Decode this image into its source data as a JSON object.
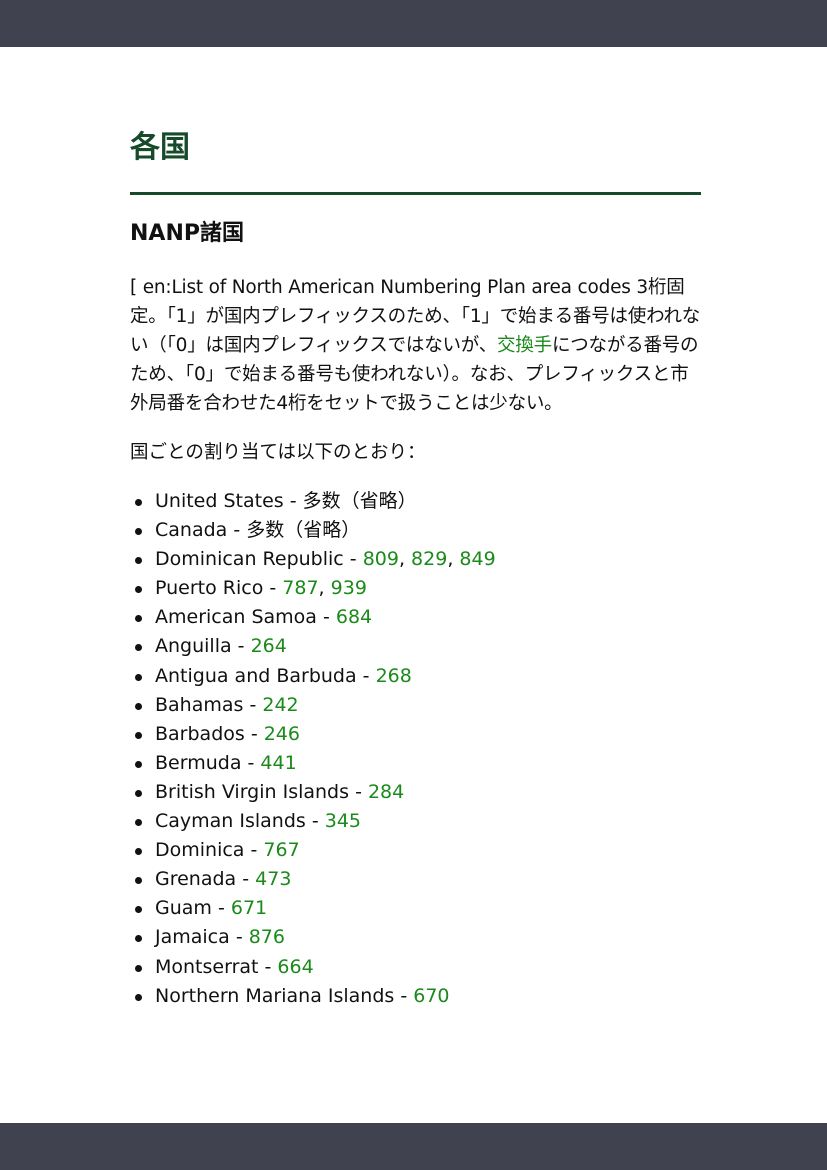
{
  "heading": "各国",
  "subheading": "NANP諸国",
  "intro": {
    "before_link": "[ en:List of North American Numbering Plan area codes 3桁固定。「1」が国内プレフィックスのため、「1」で始まる番号は使われない（「0」は国内プレフィックスではないが、",
    "link": "交換手",
    "after_link": "につながる番号のため、「0」で始まる番号も使われない）。なお、プレフィックスと市外局番を合わせた4桁をセットで扱うことは少ない。"
  },
  "allocation_intro": "国ごとの割り当ては以下のとおり：",
  "countries": [
    {
      "name": "United States",
      "sep": " - ",
      "note": "多数（省略）",
      "codes": []
    },
    {
      "name": "Canada",
      "sep": " - ",
      "note": "多数（省略）",
      "codes": []
    },
    {
      "name": "Dominican Republic",
      "sep": " - ",
      "note": "",
      "codes": [
        "809",
        "829",
        "849"
      ]
    },
    {
      "name": "Puerto Rico",
      "sep": " - ",
      "note": "",
      "codes": [
        "787",
        "939"
      ]
    },
    {
      "name": "American Samoa",
      "sep": " - ",
      "note": "",
      "codes": [
        "684"
      ]
    },
    {
      "name": "Anguilla",
      "sep": " - ",
      "note": "",
      "codes": [
        "264"
      ]
    },
    {
      "name": "Antigua and Barbuda",
      "sep": " - ",
      "note": "",
      "codes": [
        "268"
      ]
    },
    {
      "name": "Bahamas",
      "sep": " - ",
      "note": "",
      "codes": [
        "242"
      ]
    },
    {
      "name": "Barbados",
      "sep": " - ",
      "note": "",
      "codes": [
        "246"
      ]
    },
    {
      "name": "Bermuda",
      "sep": " - ",
      "note": "",
      "codes": [
        "441"
      ]
    },
    {
      "name": "British Virgin Islands",
      "sep": " - ",
      "note": "",
      "codes": [
        "284"
      ]
    },
    {
      "name": "Cayman Islands",
      "sep": " - ",
      "note": "",
      "codes": [
        "345"
      ]
    },
    {
      "name": "Dominica",
      "sep": " - ",
      "note": "",
      "codes": [
        "767"
      ]
    },
    {
      "name": "Grenada",
      "sep": " - ",
      "note": "",
      "codes": [
        "473"
      ]
    },
    {
      "name": "Guam",
      "sep": " - ",
      "note": "",
      "codes": [
        "671"
      ]
    },
    {
      "name": "Jamaica",
      "sep": " - ",
      "note": "",
      "codes": [
        "876"
      ]
    },
    {
      "name": "Montserrat",
      "sep": " - ",
      "note": "",
      "codes": [
        "664"
      ]
    },
    {
      "name": "Northern Mariana Islands",
      "sep": " - ",
      "note": "",
      "codes": [
        "670"
      ]
    }
  ],
  "colors": {
    "bar": "#40424f",
    "heading": "#164a2a",
    "link": "#1a8a1a"
  }
}
